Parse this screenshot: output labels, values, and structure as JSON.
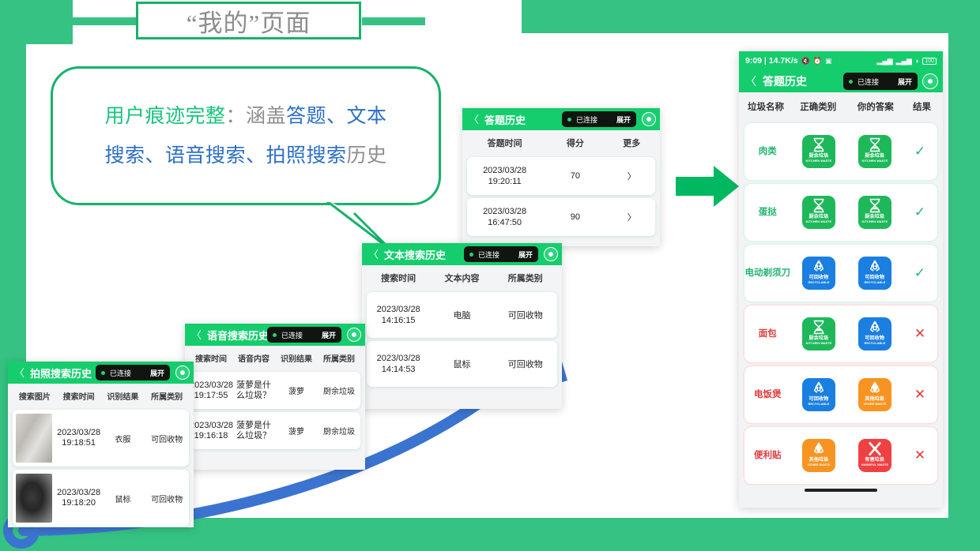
{
  "slide": {
    "title": "“我的”页面",
    "bubble_lines": [
      [
        {
          "t": "用户痕迹完整",
          "c": "green"
        },
        {
          "t": "：涵盖",
          "c": "gray"
        },
        {
          "t": "答题、文本",
          "c": "blue"
        }
      ],
      [
        {
          "t": "搜索、语音搜索、拍照搜索",
          "c": "blue"
        },
        {
          "t": "历史",
          "c": "gray"
        }
      ]
    ],
    "colors": {
      "brand_green": "#35c283",
      "bar_green": "#15cd6d",
      "accent_blue": "#2c6fc4",
      "arrow_blue": "#3b74d0",
      "text_gray": "#8d8d8d",
      "ok_green": "#23b573",
      "bad_red": "#e03b3b"
    }
  },
  "panel_quiz": {
    "title": "答题历史",
    "back_icon": "chevron-left-icon",
    "status_pill": {
      "status": "已连接",
      "expand": "展开"
    },
    "camera_icon": "record-icon",
    "columns": [
      "答题时间",
      "得分",
      "更多"
    ],
    "rows": [
      {
        "time": "2023/03/28\n19:20:11",
        "time_l1": "2023/03/28",
        "time_l2": "19:20:11",
        "score": "70",
        "more": "〉"
      },
      {
        "time": "2023/03/28\n16:47:50",
        "time_l1": "2023/03/28",
        "time_l2": "16:47:50",
        "score": "90",
        "more": "〉"
      }
    ]
  },
  "panel_text_search": {
    "title": "文本搜索历史",
    "status_pill": {
      "status": "已连接",
      "expand": "展开"
    },
    "columns": [
      "搜索时间",
      "文本内容",
      "所属类别"
    ],
    "rows": [
      {
        "time_l1": "2023/03/28",
        "time_l2": "14:16:15",
        "content": "电脑",
        "category": "可回收物"
      },
      {
        "time_l1": "2023/03/28",
        "time_l2": "14:14:53",
        "content": "鼠标",
        "category": "可回收物"
      }
    ]
  },
  "panel_voice_search": {
    "title": "语音搜索历史",
    "status_pill": {
      "status": "已连接",
      "expand": "展开"
    },
    "columns": [
      "搜索时间",
      "语音内容",
      "识别结果",
      "所属类别"
    ],
    "rows": [
      {
        "time_l1": "2023/03/28",
        "time_l2": "19:17:55",
        "voice_l1": "菠萝是什",
        "voice_l2": "么垃圾？",
        "result": "菠萝",
        "category": "厨余垃圾"
      },
      {
        "time_l1": "2023/03/28",
        "time_l2": "19:16:18",
        "voice_l1": "菠萝是什",
        "voice_l2": "么垃圾？",
        "result": "菠萝",
        "category": "厨余垃圾"
      }
    ]
  },
  "panel_photo_search": {
    "title": "拍照搜索历史",
    "status_pill": {
      "status": "已连接",
      "expand": "展开"
    },
    "columns": [
      "搜索图片",
      "搜索时间",
      "识别结果",
      "所属类别"
    ],
    "rows": [
      {
        "thumb": "clothes-photo",
        "time_l1": "2023/03/28",
        "time_l2": "19:18:51",
        "result": "衣服",
        "category": "可回收物"
      },
      {
        "thumb": "mouse-photo",
        "time_l1": "2023/03/28",
        "time_l2": "19:18:20",
        "result": "鼠标",
        "category": "可回收物"
      }
    ]
  },
  "phone": {
    "status_bar": {
      "time": "9:09",
      "network_speed": "14.7K/s",
      "left_icons": [
        "mute-icon",
        "alarm-icon",
        "screenshot-icon"
      ],
      "right_icons": [
        "signal-1-icon",
        "signal-2-icon",
        "wifi-icon"
      ],
      "battery": "100"
    },
    "nav": {
      "title": "答题历史",
      "back_icon": "chevron-left-icon",
      "status_pill": {
        "status": "已连接",
        "expand": "展开"
      },
      "camera_icon": "record-icon"
    },
    "columns": [
      "垃圾名称",
      "正确类别",
      "你的答案",
      "结果"
    ],
    "rows": [
      {
        "name": "肉类",
        "correct": {
          "type": "kitchen",
          "cn": "厨余垃圾",
          "en": "KITCHEN WASTE"
        },
        "answer": {
          "type": "kitchen",
          "cn": "厨余垃圾",
          "en": "KITCHEN WASTE"
        },
        "result": "✓",
        "correct_flag": true
      },
      {
        "name": "蛋挞",
        "correct": {
          "type": "kitchen",
          "cn": "厨余垃圾",
          "en": "KITCHEN WASTE"
        },
        "answer": {
          "type": "kitchen",
          "cn": "厨余垃圾",
          "en": "KITCHEN WASTE"
        },
        "result": "✓",
        "correct_flag": true
      },
      {
        "name": "电动剃须刀",
        "correct": {
          "type": "recycle",
          "cn": "可回收物",
          "en": "RECYCLABLE"
        },
        "answer": {
          "type": "recycle",
          "cn": "可回收物",
          "en": "RECYCLABLE"
        },
        "result": "✓",
        "correct_flag": true
      },
      {
        "name": "面包",
        "correct": {
          "type": "kitchen",
          "cn": "厨余垃圾",
          "en": "KITCHEN WASTE"
        },
        "answer": {
          "type": "recycle",
          "cn": "可回收物",
          "en": "RECYCLABLE"
        },
        "result": "✕",
        "correct_flag": false
      },
      {
        "name": "电饭煲",
        "correct": {
          "type": "recycle",
          "cn": "可回收物",
          "en": "RECYCLABLE"
        },
        "answer": {
          "type": "other",
          "cn": "其他垃圾",
          "en": "OTHER WASTE"
        },
        "result": "✕",
        "correct_flag": false
      },
      {
        "name": "便利贴",
        "correct": {
          "type": "other",
          "cn": "其他垃圾",
          "en": "OTHER WASTE"
        },
        "answer": {
          "type": "harmful",
          "cn": "有害垃圾",
          "en": "HARMFUL WASTE"
        },
        "result": "✕",
        "correct_flag": false
      }
    ]
  }
}
